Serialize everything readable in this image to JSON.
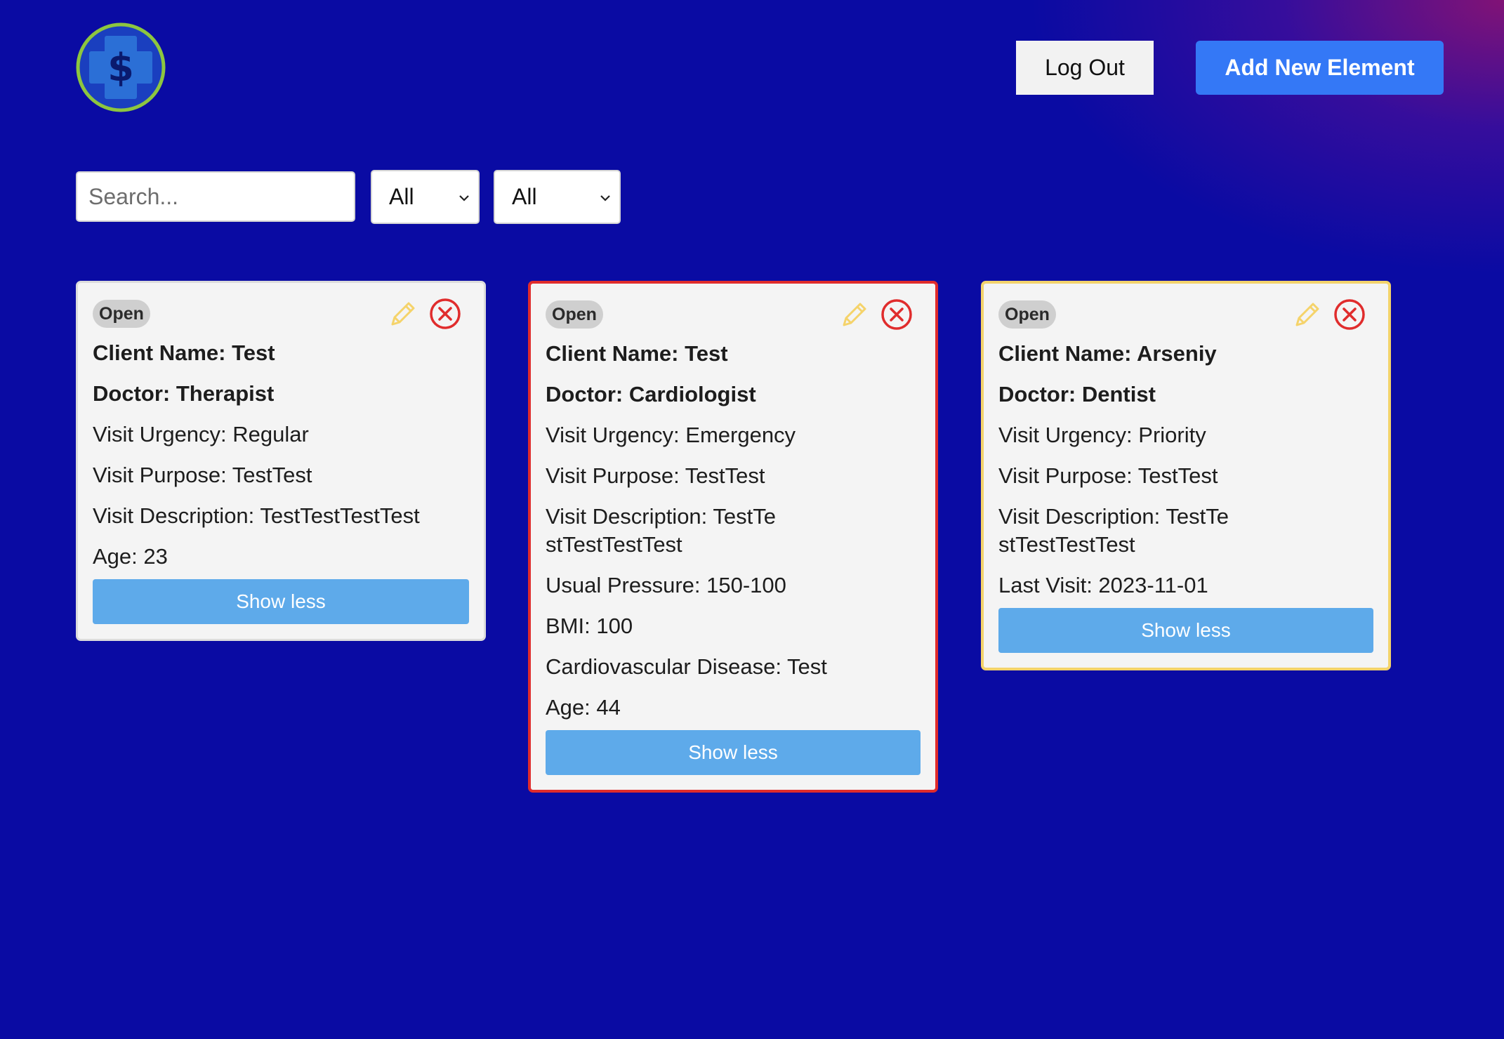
{
  "header": {
    "logo_icon": "medical-cross-dollar-icon",
    "logout_label": "Log Out",
    "add_label": "Add New Element"
  },
  "filters": {
    "search_placeholder": "Search...",
    "search_value": "",
    "select1_value": "All",
    "select2_value": "All"
  },
  "colors": {
    "background": "#0a0ba3",
    "accent_blue": "#3478f6",
    "show_less_blue": "#5eaaea",
    "emergency_border": "#e02c2c",
    "priority_border": "#f3d36b",
    "edit_icon": "#f5d36a",
    "delete_icon": "#e02c2c",
    "logo_ring": "#8dc63f",
    "logo_cross": "#2b6fd6"
  },
  "cards": [
    {
      "status": "Open",
      "client": "Client Name: Test",
      "doctor": "Doctor: Therapist",
      "urgency": "Visit Urgency: Regular",
      "purpose": "Visit Purpose: TestTest",
      "description": "Visit Description: TestTestTestTest",
      "age": "Age: 23",
      "toggle_label": "Show less"
    },
    {
      "status": "Open",
      "client": "Client Name: Test",
      "doctor": "Doctor: Cardiologist",
      "urgency": "Visit Urgency: Emergency",
      "purpose": "Visit Purpose: TestTest",
      "description": "Visit Description: TestTestTestTestTest",
      "pressure": "Usual Pressure: 150-100",
      "bmi": "BMI: 100",
      "disease": "Cardiovascular Disease: Test",
      "age": "Age: 44",
      "toggle_label": "Show less"
    },
    {
      "status": "Open",
      "client": "Client Name: Arseniy",
      "doctor": "Doctor: Dentist",
      "urgency": "Visit Urgency: Priority",
      "purpose": "Visit Purpose: TestTest",
      "description": "Visit Description: TestTestTestTestTest",
      "last_visit": "Last Visit: 2023-11-01",
      "toggle_label": "Show less"
    }
  ]
}
